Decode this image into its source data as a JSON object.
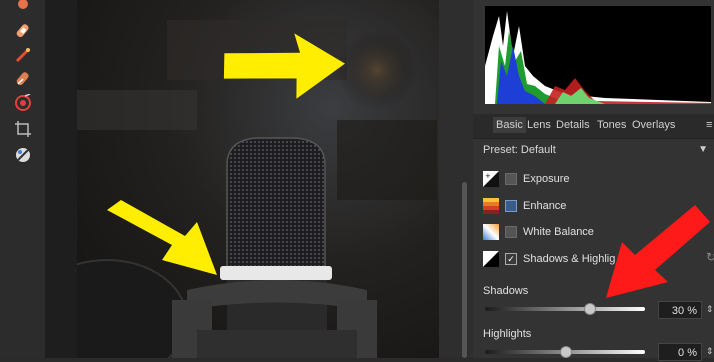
{
  "colors": {
    "accent_red": "#ff1a1a",
    "arrow_yellow": "#ffee00",
    "panel_bg": "#333333"
  },
  "toolbar": {
    "tools": [
      {
        "icon": "bandage-icon"
      },
      {
        "icon": "blemish-brush-icon"
      },
      {
        "icon": "retouch-brush-icon"
      },
      {
        "icon": "clone-brush-icon"
      },
      {
        "icon": "red-eye-icon"
      },
      {
        "icon": "crop-icon"
      },
      {
        "icon": "white-balance-picker-icon"
      }
    ]
  },
  "tabs": [
    "Basic",
    "Lens",
    "Details",
    "Tones",
    "Overlays"
  ],
  "active_tab": "Basic",
  "preset": {
    "label": "Preset:",
    "value": "Default"
  },
  "adjustments": [
    {
      "label": "Exposure",
      "checked": false,
      "icon": "exposure-icon"
    },
    {
      "label": "Enhance",
      "checked": false,
      "icon": "enhance-icon"
    },
    {
      "label": "White Balance",
      "checked": false,
      "icon": "white-balance-icon"
    },
    {
      "label": "Shadows & Highlig",
      "checked": true,
      "icon": "shadows-highlights-icon"
    }
  ],
  "sliders": [
    {
      "label": "Shadows",
      "value_text": "30 %",
      "value": 30
    },
    {
      "label": "Highlights",
      "value_text": "0 %",
      "value": 0
    }
  ]
}
